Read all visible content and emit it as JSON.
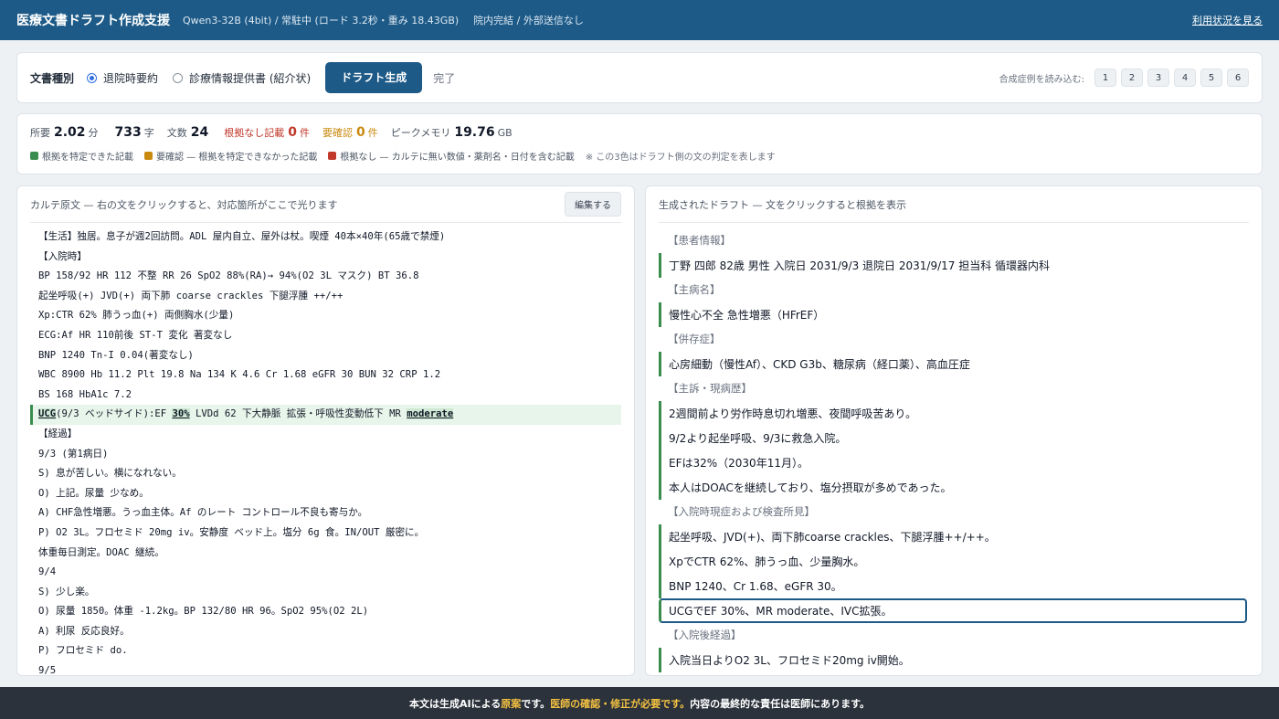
{
  "header": {
    "title": "医療文書ドラフト作成支援",
    "model": "Qwen3-32B (4bit) / 常駐中 (ロード 3.2秒・重み 18.43GB)",
    "policy": "院内完結 / 外部送信なし",
    "usage_link": "利用状況を見る"
  },
  "controls": {
    "doc_type_label": "文書種別",
    "options": [
      "退院時要約",
      "診療情報提供書 (紹介状)"
    ],
    "selected": "退院時要約",
    "generate_label": "ドラフト生成",
    "status": "完了",
    "samples_label": "合成症例を読み込む:",
    "samples": [
      "1",
      "2",
      "3",
      "4",
      "5",
      "6"
    ]
  },
  "stats": {
    "time_label": "所要",
    "time_value": "2.02",
    "time_unit": "分",
    "chars_value": "733",
    "chars_unit": "字",
    "sentences_label": "文数",
    "sentences_value": "24",
    "unsupported_label": "根拠なし記載",
    "unsupported_value": "0",
    "unsupported_unit": "件",
    "check_label": "要確認",
    "check_value": "0",
    "check_unit": "件",
    "memory_label": "ピークメモリ",
    "memory_value": "19.76",
    "memory_unit": "GB"
  },
  "legend": {
    "items": [
      {
        "label": "根拠を特定できた記載",
        "color": "#3a8d4f"
      },
      {
        "label": "要確認 — 根拠を特定できなかった記載",
        "color": "#c98a10"
      },
      {
        "label": "根拠なし — カルテに無い数値・薬剤名・日付を含む記載",
        "color": "#c0392b"
      }
    ],
    "note": "※ この3色はドラフト側の文の判定を表します"
  },
  "karte": {
    "title": "カルテ原文 — 右の文をクリックすると、対応箇所がここで光ります",
    "edit_label": "編集する",
    "lines": [
      "【生活】独居。息子が週2回訪問。ADL 屋内自立、屋外は杖。喫煙 40本×40年(65歳で禁煙)",
      "【入院時】",
      "BP 158/92 HR 112 不整 RR 26 SpO2 88%(RA)→ 94%(O2 3L マスク) BT 36.8",
      "起坐呼吸(+) JVD(+) 両下肺 coarse crackles 下腿浮腫 ++/++",
      "Xp:CTR 62% 肺うっ血(+) 両側胸水(少量)",
      "ECG:Af HR 110前後 ST-T 変化 著変なし",
      "BNP 1240  Tn-I 0.04(著変なし)",
      "WBC 8900 Hb 11.2 Plt 19.8 Na 134 K 4.6 Cr 1.68 eGFR 30 BUN 32 CRP 1.2",
      "BS 168 HbA1c 7.2",
      "UCG(9/3 ベッドサイド):EF 30% LVDd 62 下大静脈 拡張・呼吸性変動低下 MR moderate",
      "【経過】",
      "9/3 (第1病日)",
      "S) 息が苦しい。横になれない。",
      "O) 上記。尿量 少なめ。",
      "A) CHF急性増悪。うっ血主体。Af のレート コントロール不良も寄与か。",
      "P) O2 3L。フロセミド 20mg iv。安静度 ベッド上。塩分 6g 食。IN/OUT 厳密に。",
      "体重毎日測定。DOAC 継続。",
      "9/4",
      "S) 少し楽。",
      "O) 尿量 1850。体重 -1.2kg。BP 132/80 HR 96。SpO2 95%(O2 2L)",
      "A) 利尿 反応良好。",
      "P) フロセミド do.",
      "9/5"
    ],
    "hl_parts": [
      "UCG",
      "(9/3 ベッドサイド):EF ",
      "30%",
      " LVDd 62 下大静脈 拡張・呼吸性変動低下 MR ",
      "moderate"
    ]
  },
  "draft": {
    "title": "生成されたドラフト — 文をクリックすると根拠を表示",
    "blocks": [
      {
        "section": "【患者情報】",
        "lines": [
          "丁野 四郎 82歳 男性 入院日 2031/9/3 退院日 2031/9/17 担当科 循環器内科"
        ]
      },
      {
        "section": "【主病名】",
        "lines": [
          "慢性心不全 急性増悪（HFrEF）"
        ]
      },
      {
        "section": "【併存症】",
        "lines": [
          "心房細動（慢性Af）、CKD G3b、糖尿病（経口薬）、高血圧症"
        ]
      },
      {
        "section": "【主訴・現病歴】",
        "lines": [
          "2週間前より労作時息切れ増悪、夜間呼吸苦あり。",
          "9/2より起坐呼吸、9/3に救急入院。",
          "EFは32%（2030年11月）。",
          "本人はDOACを継続しており、塩分摂取が多めであった。"
        ]
      },
      {
        "section": "【入院時現症および検査所見】",
        "lines": [
          "起坐呼吸、JVD(+)、両下肺coarse crackles、下腿浮腫++/++。",
          "XpでCTR 62%、肺うっ血、少量胸水。",
          "BNP 1240、Cr 1.68、eGFR 30。",
          "UCGでEF 30%、MR moderate、IVC拡張。"
        ]
      },
      {
        "section": "【入院後経過】",
        "lines": [
          "入院当日よりO2 3L、フロセミド20mg iv開始。"
        ]
      }
    ]
  },
  "footer": {
    "p1": "本文は生成AIによる",
    "p2": "原案",
    "p3": "です。",
    "p4": "医師の確認・修正が必要です。",
    "p5": "内容の最終的な責任は医師にあります。"
  }
}
